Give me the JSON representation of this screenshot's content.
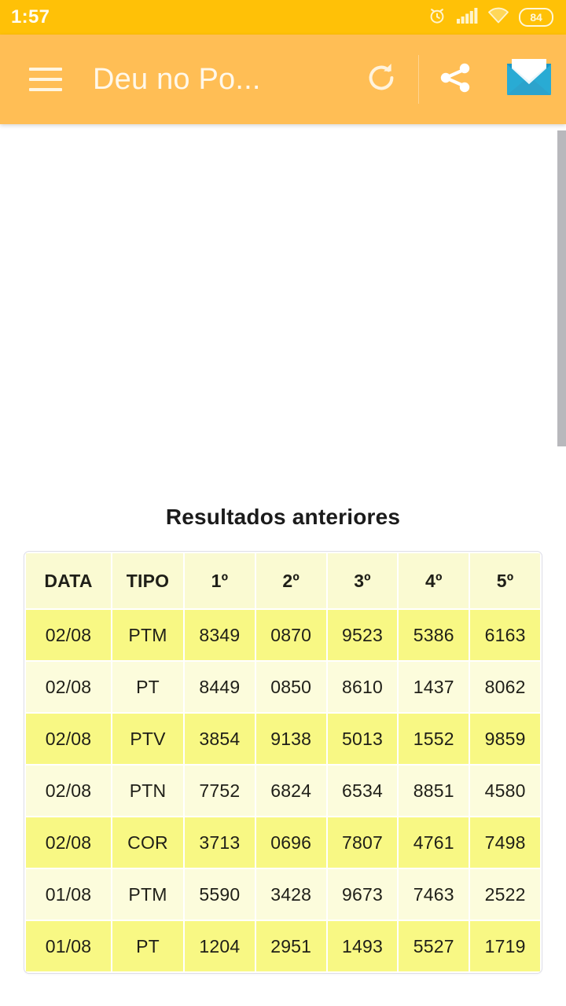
{
  "status_bar": {
    "time": "1:57",
    "battery_level": "84",
    "icons": [
      "alarm-icon",
      "signal-icon",
      "wifi-icon",
      "battery-icon"
    ],
    "background_color": "#FFC107"
  },
  "toolbar": {
    "title": "Deu no Po...",
    "menu_label": "menu",
    "refresh_label": "refresh",
    "share_label": "share",
    "mail_label": "mail",
    "background_color": "#FFBE55",
    "mail_icon_color": "#29ABD4"
  },
  "main": {
    "results_title": "Resultados anteriores",
    "table": {
      "headers": [
        "DATA",
        "TIPO",
        "1º",
        "2º",
        "3º",
        "4º",
        "5º"
      ],
      "rows": [
        {
          "data": "02/08",
          "tipo": "PTM",
          "p1": "8349",
          "p2": "0870",
          "p3": "9523",
          "p4": "5386",
          "p5": "6163"
        },
        {
          "data": "02/08",
          "tipo": "PT",
          "p1": "8449",
          "p2": "0850",
          "p3": "8610",
          "p4": "1437",
          "p5": "8062"
        },
        {
          "data": "02/08",
          "tipo": "PTV",
          "p1": "3854",
          "p2": "9138",
          "p3": "5013",
          "p4": "1552",
          "p5": "9859"
        },
        {
          "data": "02/08",
          "tipo": "PTN",
          "p1": "7752",
          "p2": "6824",
          "p3": "6534",
          "p4": "8851",
          "p5": "4580"
        },
        {
          "data": "02/08",
          "tipo": "COR",
          "p1": "3713",
          "p2": "0696",
          "p3": "7807",
          "p4": "4761",
          "p5": "7498"
        },
        {
          "data": "01/08",
          "tipo": "PTM",
          "p1": "5590",
          "p2": "3428",
          "p3": "9673",
          "p4": "7463",
          "p5": "2522"
        },
        {
          "data": "01/08",
          "tipo": "PT",
          "p1": "1204",
          "p2": "2951",
          "p3": "1493",
          "p4": "5527",
          "p5": "1719"
        }
      ],
      "header_color": "#FAFAD2",
      "row_odd_color": "#F8F884",
      "row_even_color": "#FCFCDC"
    }
  }
}
